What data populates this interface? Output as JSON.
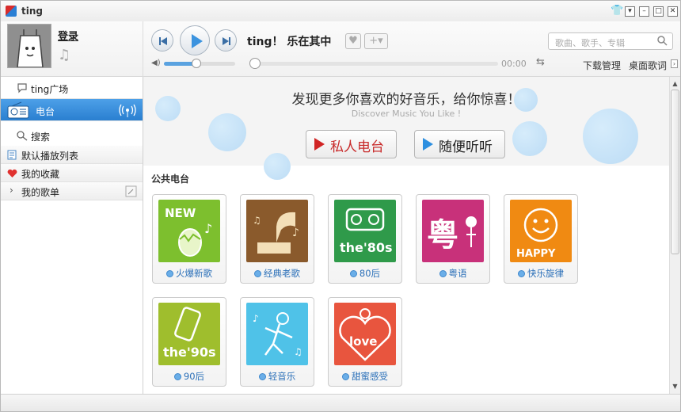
{
  "window": {
    "title": "ting"
  },
  "profile": {
    "login": "登录"
  },
  "player": {
    "now_playing": "ting！ 乐在其中",
    "time": "00:00",
    "volume": 0.45,
    "progress": 0.0
  },
  "search": {
    "placeholder": "歌曲、歌手、专辑"
  },
  "header_links": {
    "download": "下载管理",
    "lyrics": "桌面歌词"
  },
  "sidebar": {
    "nav": [
      "ting广场",
      "电台",
      "搜索"
    ],
    "lists": [
      "默认播放列表",
      "我的收藏",
      "我的歌单"
    ]
  },
  "banner": {
    "title": "发现更多你喜欢的好音乐，给你惊喜！",
    "subtitle": "Discover Music You Like !",
    "private_radio": "私人电台",
    "random_listen": "随便听听"
  },
  "section": {
    "title": "公共电台"
  },
  "stations": [
    {
      "name": "火爆新歌",
      "art_text": "NEW",
      "color": "#7dbf2e"
    },
    {
      "name": "经典老歌",
      "art_text": "",
      "color": "#8a5a2c"
    },
    {
      "name": "80后",
      "art_text": "the'80s",
      "color": "#2f9a4a"
    },
    {
      "name": "粤语",
      "art_text": "粤",
      "color": "#c8317a"
    },
    {
      "name": "快乐旋律",
      "art_text": "HAPPY",
      "color": "#f08a12"
    },
    {
      "name": "90后",
      "art_text": "the'90s",
      "color": "#9fbe2d"
    },
    {
      "name": "轻音乐",
      "art_text": "",
      "color": "#4fc2e8"
    },
    {
      "name": "甜蜜感受",
      "art_text": "love",
      "color": "#e8553e"
    }
  ]
}
